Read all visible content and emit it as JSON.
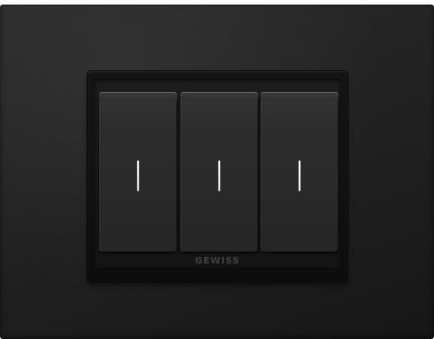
{
  "device": {
    "type": "three-gang rocker light switch",
    "plate_color": "#1f1f1f",
    "frame_color": "#111111",
    "indicator_color": "#f0f0f0",
    "rocker_count": 3,
    "brand_text": "GEWISS"
  },
  "rockers": [
    {
      "indicator_icon": "vertical-line-indicator"
    },
    {
      "indicator_icon": "vertical-line-indicator"
    },
    {
      "indicator_icon": "vertical-line-indicator"
    }
  ]
}
